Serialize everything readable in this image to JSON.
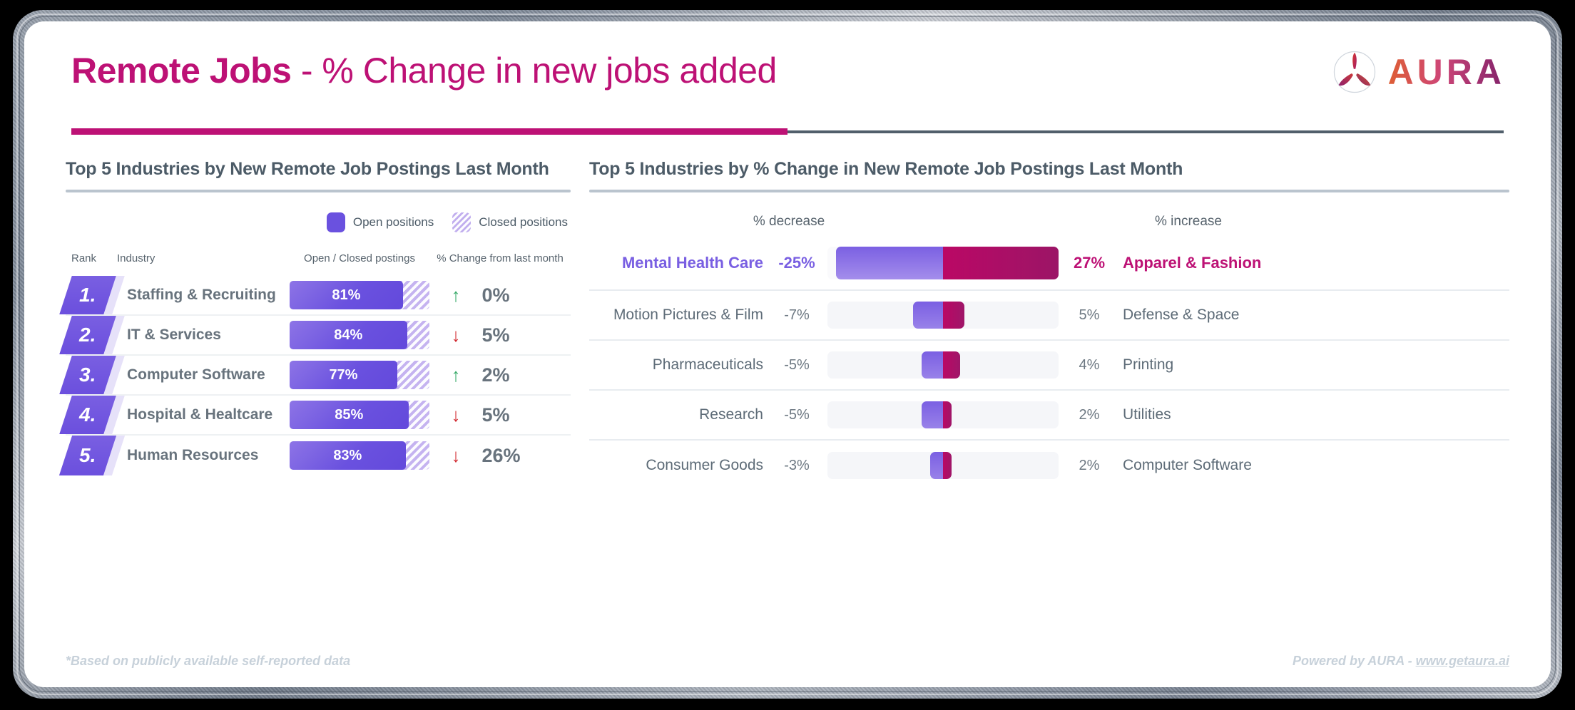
{
  "header": {
    "title_strong": "Remote Jobs",
    "title_light": " - % Change in new jobs added",
    "logo_text": "AURA",
    "logo_mark_icon": "aura-propeller-icon",
    "accent_pink": "#d4097f",
    "accent_purple": "#6c4ef5",
    "rule_grey": "#4f5f6d"
  },
  "left_panel": {
    "title": "Top 5 Industries by New Remote Job Postings Last Month",
    "legend": [
      {
        "label": "Open positions",
        "swatch": "solid-purple"
      },
      {
        "label": "Closed positions",
        "swatch": "hatched-lavender"
      }
    ],
    "columns": {
      "rank": "Rank",
      "industry": "Industry",
      "bar": "Open / Closed postings",
      "change": "% Change from last month"
    },
    "rows": [
      {
        "rank": "1.",
        "industry": "Staffing & Recruiting",
        "open_pct": "81%",
        "open_value": 81,
        "arrow": "up",
        "arrow_glyph": "↑",
        "change": "0%"
      },
      {
        "rank": "2.",
        "industry": "IT & Services",
        "open_pct": "84%",
        "open_value": 84,
        "arrow": "down",
        "arrow_glyph": "↓",
        "change": "5%"
      },
      {
        "rank": "3.",
        "industry": "Computer Software",
        "open_pct": "77%",
        "open_value": 77,
        "arrow": "up",
        "arrow_glyph": "↑",
        "change": "2%"
      },
      {
        "rank": "4.",
        "industry": "Hospital & Healtcare",
        "open_pct": "85%",
        "open_value": 85,
        "arrow": "down",
        "arrow_glyph": "↓",
        "change": "5%"
      },
      {
        "rank": "5.",
        "industry": "Human Resources",
        "open_pct": "83%",
        "open_value": 83,
        "arrow": "down",
        "arrow_glyph": "↓",
        "change": "26%"
      }
    ]
  },
  "right_panel": {
    "title": "Top 5 Industries by % Change in New Remote Job Postings Last Month",
    "decrease_header": "% decrease",
    "increase_header": "% increase",
    "rows": [
      {
        "left_label": "Mental Health Care",
        "left_value": "-25%",
        "left_num": -25,
        "right_value": "27%",
        "right_num": 27,
        "right_label": "Apparel & Fashion",
        "highlight": true
      },
      {
        "left_label": "Motion Pictures & Film",
        "left_value": "-7%",
        "left_num": -7,
        "right_value": "5%",
        "right_num": 5,
        "right_label": "Defense & Space",
        "highlight": false
      },
      {
        "left_label": "Pharmaceuticals",
        "left_value": "-5%",
        "left_num": -5,
        "right_value": "4%",
        "right_num": 4,
        "right_label": "Printing",
        "highlight": false
      },
      {
        "left_label": "Research",
        "left_value": "-5%",
        "left_num": -5,
        "right_value": "2%",
        "right_num": 2,
        "right_label": "Utilities",
        "highlight": false
      },
      {
        "left_label": "Consumer Goods",
        "left_value": "-3%",
        "left_num": -3,
        "right_value": "2%",
        "right_num": 2,
        "right_label": "Computer Software",
        "highlight": false
      }
    ]
  },
  "footer": {
    "note": "*Based on publicly available self-reported data",
    "powered_prefix": "Powered by AURA - ",
    "powered_link": "www.getaura.ai"
  },
  "chart_data": [
    {
      "type": "bar",
      "title": "Top 5 Industries by New Remote Job Postings Last Month",
      "orientation": "horizontal",
      "categories": [
        "Staffing & Recruiting",
        "IT & Services",
        "Computer Software",
        "Hospital & Healtcare",
        "Human Resources"
      ],
      "series": [
        {
          "name": "Open positions",
          "values": [
            81,
            84,
            77,
            85,
            83
          ]
        },
        {
          "name": "Closed positions",
          "values": [
            19,
            16,
            23,
            15,
            17
          ]
        }
      ],
      "annotations": {
        "change_from_last_month": [
          "0%",
          "-5%",
          "2%",
          "-5%",
          "-26%"
        ],
        "change_direction": [
          "up",
          "down",
          "up",
          "down",
          "down"
        ]
      },
      "xlabel": "Open / Closed postings",
      "ylabel": "Industry",
      "xlim": [
        0,
        100
      ],
      "grid": false,
      "legend_position": "top-right",
      "stacked": true
    },
    {
      "type": "bar",
      "title": "Top 5 Industries by % Change in New Remote Job Postings Last Month",
      "orientation": "horizontal",
      "style": "diverging",
      "axis_labels": {
        "left": "% decrease",
        "right": "% increase"
      },
      "rows": [
        {
          "decrease_category": "Mental Health Care",
          "decrease": -25,
          "increase": 27,
          "increase_category": "Apparel & Fashion"
        },
        {
          "decrease_category": "Motion Pictures & Film",
          "decrease": -7,
          "increase": 5,
          "increase_category": "Defense & Space"
        },
        {
          "decrease_category": "Pharmaceuticals",
          "decrease": -5,
          "increase": 4,
          "increase_category": "Printing"
        },
        {
          "decrease_category": "Research",
          "decrease": -5,
          "increase": 2,
          "increase_category": "Utilities"
        },
        {
          "decrease_category": "Consumer Goods",
          "decrease": -3,
          "increase": 2,
          "increase_category": "Computer Software"
        }
      ],
      "xlim": [
        -27,
        27
      ],
      "grid": false,
      "legend_position": "none"
    }
  ]
}
